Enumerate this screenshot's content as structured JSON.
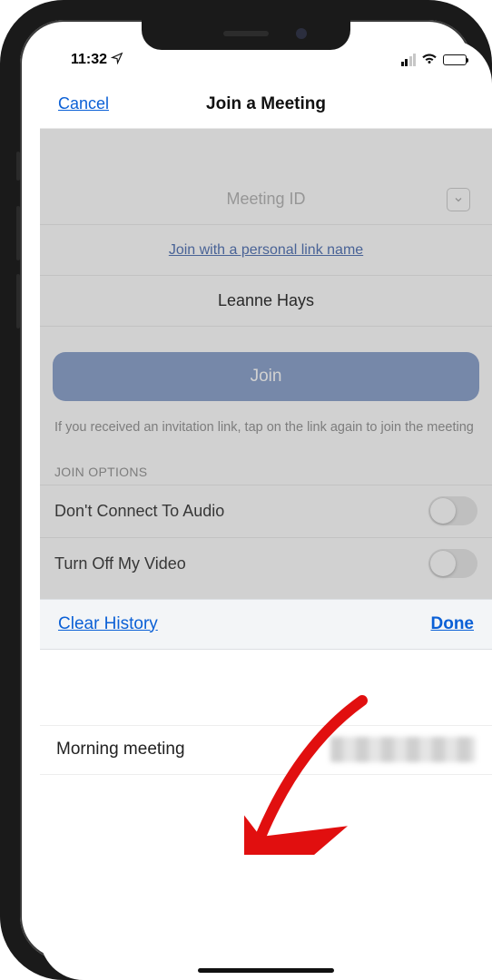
{
  "status": {
    "time": "11:32"
  },
  "nav": {
    "cancel": "Cancel",
    "title": "Join a Meeting"
  },
  "form": {
    "meeting_id_placeholder": "Meeting ID",
    "personal_link": "Join with a personal link name",
    "name_value": "Leanne Hays",
    "join_label": "Join",
    "hint": "If you received an invitation link, tap on the link again to join the meeting"
  },
  "options": {
    "section_label": "JOIN OPTIONS",
    "audio_label": "Don't Connect To Audio",
    "video_label": "Turn Off My Video"
  },
  "history": {
    "clear_label": "Clear History",
    "done_label": "Done",
    "items": [
      {
        "title": "Morning meeting"
      }
    ]
  }
}
